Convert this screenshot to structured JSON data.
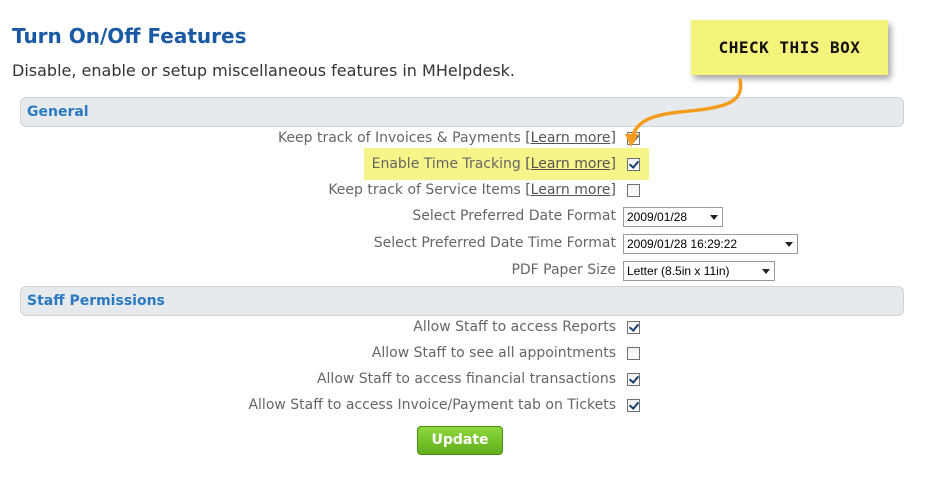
{
  "page": {
    "title": "Turn On/Off Features",
    "subtitle": "Disable, enable or setup miscellaneous features in MHelpdesk."
  },
  "callout": {
    "text": "CHECK THIS BOX",
    "color": "#f4f47c"
  },
  "sections": {
    "general": {
      "title": "General",
      "rows": [
        {
          "label": "Keep track of Invoices & Payments",
          "link": "[Learn more]",
          "checked": true
        },
        {
          "label": "Enable Time Tracking",
          "link": "[Learn more]",
          "checked": true
        },
        {
          "label": "Keep track of Service Items",
          "link": "[Learn more]",
          "checked": false
        }
      ],
      "selects": [
        {
          "label": "Select Preferred Date Format",
          "value": "2009/01/28"
        },
        {
          "label": "Select Preferred Date Time Format",
          "value": "2009/01/28 16:29:22"
        },
        {
          "label": "PDF Paper Size",
          "value": "Letter (8.5in x 11in)"
        }
      ]
    },
    "staff": {
      "title": "Staff Permissions",
      "rows": [
        {
          "label": "Allow Staff to access Reports",
          "checked": true
        },
        {
          "label": "Allow Staff to see all appointments",
          "checked": false
        },
        {
          "label": "Allow Staff to access financial transactions",
          "checked": true
        },
        {
          "label": "Allow Staff to access Invoice/Payment tab on Tickets",
          "checked": true
        }
      ]
    }
  },
  "update_button": {
    "label": "Update",
    "color": "#6cc02a"
  },
  "colors": {
    "title": "#1a5aa5",
    "section_header": "#2a79c3",
    "highlight": "#f6f58a",
    "arrow": "#f39c1e"
  }
}
